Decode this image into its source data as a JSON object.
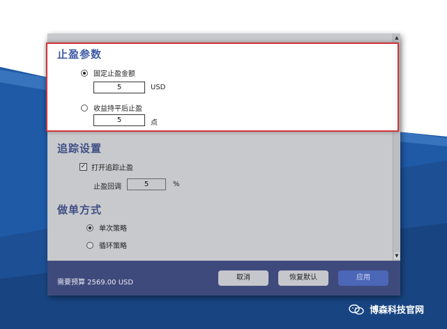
{
  "stop_profit": {
    "title": "止盈参数",
    "fixed_label": "固定止盈金额",
    "fixed_value": "5",
    "fixed_unit": "USD",
    "pullback_label": "收益持平后止盈",
    "pullback_value": "5",
    "pullback_unit": "点",
    "selected": "fixed"
  },
  "trailing": {
    "title": "追踪设置",
    "enable_label": "打开追踪止盈",
    "enable_checked": true,
    "pullback_label": "止盈回调",
    "pullback_value": "5",
    "pullback_unit": "%"
  },
  "order_mode": {
    "title": "做单方式",
    "single_label": "单次策略",
    "loop_label": "循环策略",
    "selected": "single"
  },
  "footer": {
    "budget_text": "需要预算 2569.00 USD",
    "cancel_label": "取消",
    "reset_label": "恢复默认",
    "apply_label": "应用"
  },
  "watermark": {
    "text": "博森科技官网",
    "icon": "wechat-icon"
  },
  "colors": {
    "highlight_border": "#d0353a",
    "section_title": "#3e5aa6",
    "footer_bg": "#3f4a7c",
    "apply_button": "#4c66b8",
    "slide_blue": "#1f5aa6"
  }
}
